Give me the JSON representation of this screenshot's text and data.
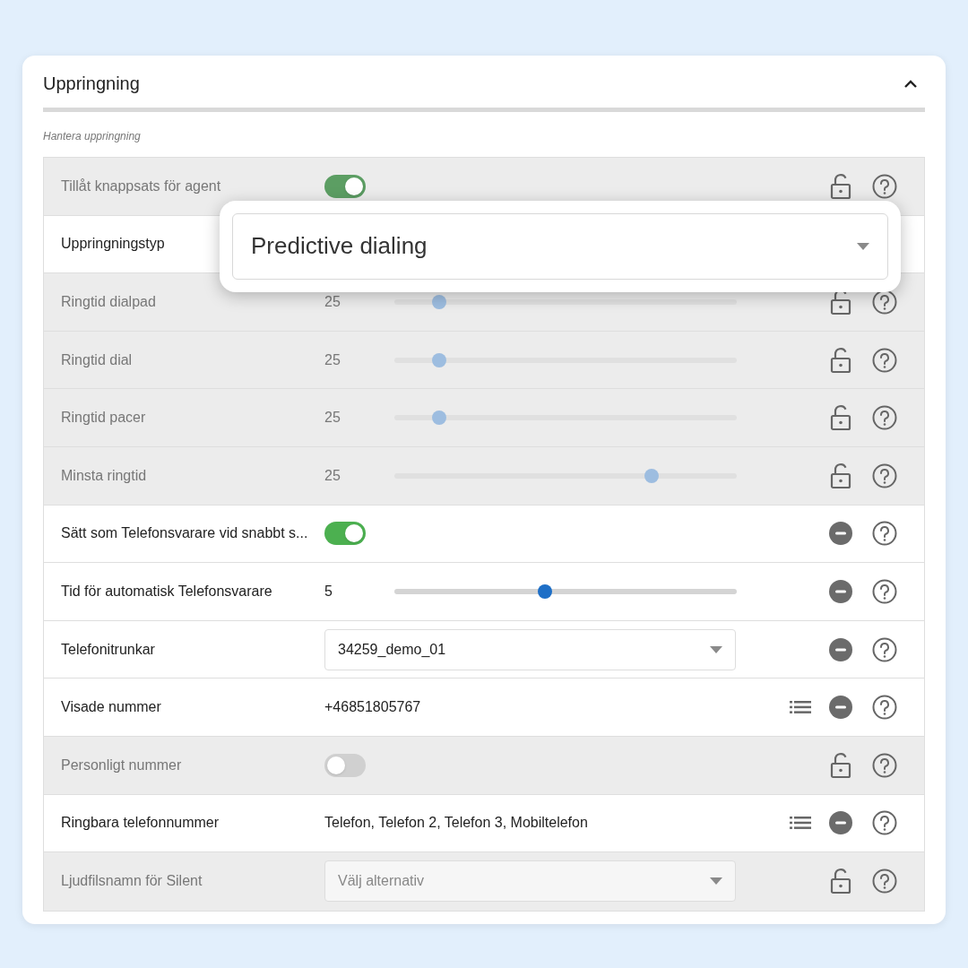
{
  "section": {
    "title": "Uppringning",
    "expanded": true,
    "subtitle": "Hantera uppringning"
  },
  "rows": [
    {
      "label": "Tillåt knappsats för agent",
      "kind": "toggle",
      "on": true,
      "locked": true
    },
    {
      "label": "Uppringningstyp",
      "kind": "popup",
      "value": "Predictive dialing",
      "locked": false
    },
    {
      "label": "Ringtid dialpad",
      "kind": "slider",
      "reading": "25",
      "level": 0.13,
      "locked": true
    },
    {
      "label": "Ringtid dial",
      "kind": "slider",
      "reading": "25",
      "level": 0.13,
      "locked": true
    },
    {
      "label": "Ringtid pacer",
      "kind": "slider",
      "reading": "25",
      "level": 0.13,
      "locked": true
    },
    {
      "label": "Minsta ringtid",
      "kind": "slider",
      "reading": "25",
      "level": 0.75,
      "locked": true
    },
    {
      "label": "Sätt som Telefonsvarare vid snabbt s...",
      "kind": "toggle",
      "on": true,
      "locked": false
    },
    {
      "label": "Tid för automatisk Telefonsvarare",
      "kind": "slider",
      "reading": "5",
      "level": 0.44,
      "locked": false
    },
    {
      "label": "Telefonitrunkar",
      "kind": "select",
      "value": "34259_demo_01",
      "locked": false
    },
    {
      "label": "Visade nummer",
      "kind": "text",
      "value": "+46851805767",
      "list": true,
      "locked": false
    },
    {
      "label": "Personligt nummer",
      "kind": "toggle",
      "on": false,
      "locked": true
    },
    {
      "label": "Ringbara telefonnummer",
      "kind": "text",
      "value": "Telefon, Telefon 2, Telefon 3, Mobiltelefon",
      "list": true,
      "locked": false
    },
    {
      "label": "Ljudfilsnamn för Silent",
      "kind": "select",
      "placeholder": "Välj alternativ",
      "locked": true
    }
  ]
}
